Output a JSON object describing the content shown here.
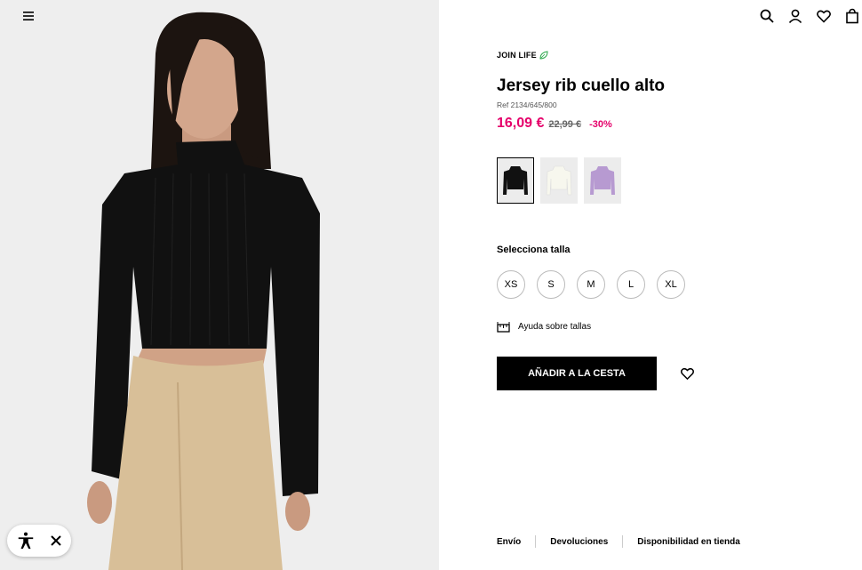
{
  "header": {
    "menu_icon": "hamburger-menu-icon",
    "icons": [
      "search-icon",
      "user-icon",
      "heart-icon",
      "bag-icon"
    ]
  },
  "product": {
    "badge": "JOIN LIFE",
    "badge_icon": "leaf-icon",
    "title": "Jersey rib cuello alto",
    "ref": "Ref 2134/645/800",
    "price_current": "16,09 €",
    "price_original": "22,99 €",
    "discount": "-30%",
    "price_color": "#e5006a"
  },
  "colors": [
    {
      "name": "black",
      "hex": "#111111",
      "selected": true
    },
    {
      "name": "white",
      "hex": "#f2f2ea",
      "selected": false
    },
    {
      "name": "lilac",
      "hex": "#b79ad1",
      "selected": false
    }
  ],
  "sizes": {
    "label": "Selecciona talla",
    "options": [
      "XS",
      "S",
      "M",
      "L",
      "XL"
    ]
  },
  "size_help": {
    "label": "Ayuda sobre tallas",
    "icon": "ruler-icon"
  },
  "actions": {
    "add_to_cart": "AÑADIR A LA CESTA",
    "wishlist_icon": "heart-icon"
  },
  "footer": {
    "links": [
      "Envío",
      "Devoluciones",
      "Disponibilidad en tienda"
    ]
  },
  "accessibility": {
    "icon": "accessibility-icon",
    "close_icon": "close-icon"
  }
}
